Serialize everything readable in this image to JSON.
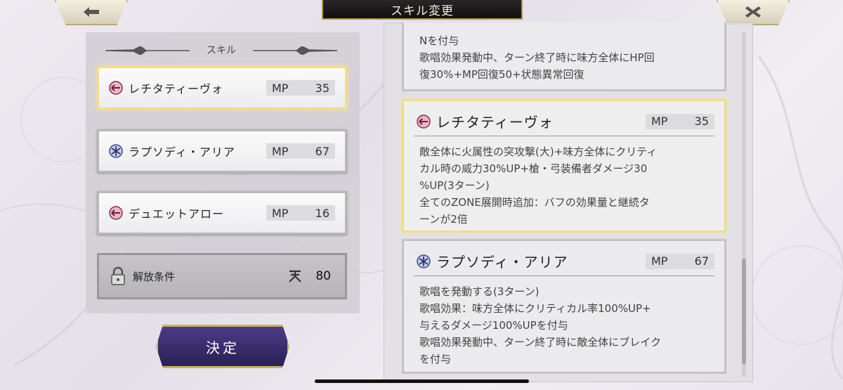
{
  "header": {
    "title": "スキル変更"
  },
  "left_panel": {
    "header": "スキル",
    "skills": [
      {
        "name": "レチタティーヴォ",
        "mp_label": "MP",
        "mp": "35",
        "icon": "fire-arrow-icon",
        "selected": true
      },
      {
        "name": "ラプソディ・アリア",
        "mp_label": "MP",
        "mp": "67",
        "icon": "snowflake-icon",
        "selected": false
      },
      {
        "name": "デュエットアロー",
        "mp_label": "MP",
        "mp": "16",
        "icon": "fire-arrow-icon",
        "selected": false
      }
    ],
    "locked": {
      "label": "解放条件",
      "value": "80",
      "icon": "sky-kanji-icon"
    },
    "decide_label": "決定"
  },
  "right_panel": {
    "partial_card": {
      "lines": [
        "Nを付与",
        "歌唱効果発動中、ターン終了時に味方全体にHP回",
        "復30%+MP回復50+状態異常回復"
      ]
    },
    "cards": [
      {
        "name": "レチタティーヴォ",
        "mp_label": "MP",
        "mp": "35",
        "icon": "fire-arrow-icon",
        "lines": [
          "敵全体に火属性の突攻撃(大)+味方全体にクリティ",
          "カル時の威力30%UP+槍・弓装備者ダメージ30",
          "%UP(3ターン)",
          "全てのZONE展開時追加：バフの効果量と継続タ",
          "ーンが2倍"
        ]
      },
      {
        "name": "ラプソディ・アリア",
        "mp_label": "MP",
        "mp": "67",
        "icon": "snowflake-icon",
        "lines": [
          "歌唱を発動する(3ターン)",
          "歌唱効果：味方全体にクリティカル率100%UP+",
          "与えるダメージ100%UPを付与",
          "歌唱効果発動中、ターン終了時に敵全体にブレイク",
          "を付与"
        ]
      }
    ]
  }
}
